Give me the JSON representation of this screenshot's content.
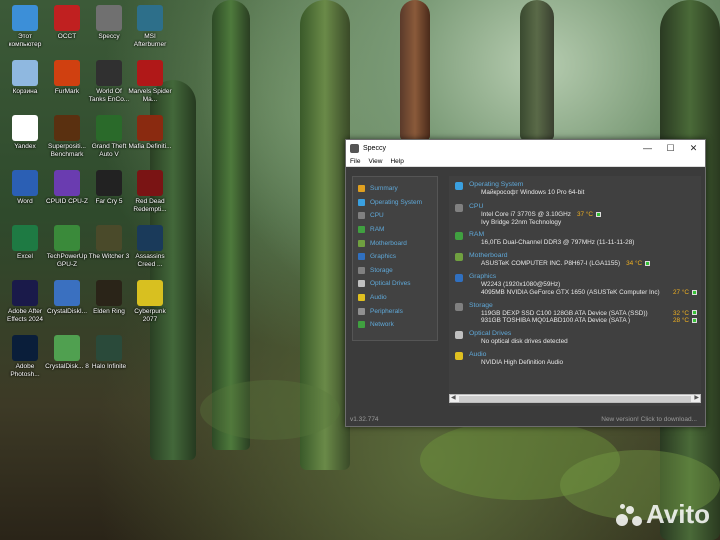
{
  "desktop_icons": [
    {
      "label": "Этот компьютер",
      "icon": "this-pc-icon",
      "color": "#3c8fd8"
    },
    {
      "label": "OCCT",
      "icon": "occt-icon",
      "color": "#c02020"
    },
    {
      "label": "Speccy",
      "icon": "speccy-icon",
      "color": "#707070"
    },
    {
      "label": "MSI Afterburner",
      "icon": "msi-afterburner-icon",
      "color": "#2d6f8a"
    },
    {
      "label": "Корзина",
      "icon": "recycle-bin-icon",
      "color": "#8fb8e0"
    },
    {
      "label": "FurMark",
      "icon": "furmark-icon",
      "color": "#d04010"
    },
    {
      "label": "World Of Tanks EnCo...",
      "icon": "world-of-tanks-icon",
      "color": "#303030"
    },
    {
      "label": "Marvels Spider Ma...",
      "icon": "spider-man-icon",
      "color": "#b01818"
    },
    {
      "label": "Yandex",
      "icon": "yandex-icon",
      "color": "#ffffff"
    },
    {
      "label": "Superpositi... Benchmark",
      "icon": "superposition-icon",
      "color": "#5a3010"
    },
    {
      "label": "Grand Theft Auto V",
      "icon": "gta-v-icon",
      "color": "#2a6a2a"
    },
    {
      "label": "Mafia Definiti...",
      "icon": "mafia-icon",
      "color": "#8a2a10"
    },
    {
      "label": "Word",
      "icon": "word-icon",
      "color": "#2b5fb4"
    },
    {
      "label": "CPUID CPU-Z",
      "icon": "cpu-z-icon",
      "color": "#6a3cb0"
    },
    {
      "label": "Far Cry 5",
      "icon": "far-cry-5-icon",
      "color": "#222222"
    },
    {
      "label": "Red Dead Redempti...",
      "icon": "red-dead-icon",
      "color": "#7a1414"
    },
    {
      "label": "Excel",
      "icon": "excel-icon",
      "color": "#1e7a43"
    },
    {
      "label": "TechPowerUp GPU-Z",
      "icon": "gpu-z-icon",
      "color": "#3a8a3a"
    },
    {
      "label": "The Witcher 3",
      "icon": "witcher-3-icon",
      "color": "#4a4a2a"
    },
    {
      "label": "Assassins Creed ...",
      "icon": "assassins-creed-icon",
      "color": "#1a3a5a"
    },
    {
      "label": "Adobe After Effects 2024",
      "icon": "after-effects-icon",
      "color": "#1a1a4a"
    },
    {
      "label": "CrystalDiskI...",
      "icon": "crystaldiskinfo-icon",
      "color": "#3a70c0"
    },
    {
      "label": "Elden Ring",
      "icon": "elden-ring-icon",
      "color": "#2a2418"
    },
    {
      "label": "Cyberpunk 2077",
      "icon": "cyberpunk-icon",
      "color": "#d8c020"
    },
    {
      "label": "Adobe Photosh...",
      "icon": "photoshop-icon",
      "color": "#0a1e3a"
    },
    {
      "label": "CrystalDisk... 8",
      "icon": "crystaldiskmark-icon",
      "color": "#50a050"
    },
    {
      "label": "Halo Infinite",
      "icon": "halo-icon",
      "color": "#2a4a3a"
    }
  ],
  "window": {
    "title": "Speccy",
    "menu": [
      "File",
      "View",
      "Help"
    ],
    "nav": [
      {
        "label": "Summary",
        "icon": "summary-icon",
        "color": "#e0a020"
      },
      {
        "label": "Operating System",
        "icon": "windows-icon",
        "color": "#3aa0e0"
      },
      {
        "label": "CPU",
        "icon": "cpu-icon",
        "color": "#808080"
      },
      {
        "label": "RAM",
        "icon": "ram-icon",
        "color": "#40a040"
      },
      {
        "label": "Motherboard",
        "icon": "motherboard-icon",
        "color": "#70a040"
      },
      {
        "label": "Graphics",
        "icon": "graphics-icon",
        "color": "#3070c0"
      },
      {
        "label": "Storage",
        "icon": "storage-icon",
        "color": "#808080"
      },
      {
        "label": "Optical Drives",
        "icon": "optical-drive-icon",
        "color": "#c0c0c0"
      },
      {
        "label": "Audio",
        "icon": "audio-icon",
        "color": "#e0c020"
      },
      {
        "label": "Peripherals",
        "icon": "peripherals-icon",
        "color": "#909090"
      },
      {
        "label": "Network",
        "icon": "network-icon",
        "color": "#40a040"
      }
    ],
    "sections": [
      {
        "heading": "Operating System",
        "icon": "windows-icon",
        "color": "#3aa0e0",
        "lines": [
          {
            "text": "Майкрософт Windows 10 Pro 64-bit"
          }
        ]
      },
      {
        "heading": "CPU",
        "icon": "cpu-icon",
        "color": "#808080",
        "lines": [
          {
            "text": "Intel Core i7 3770S @ 3.10GHz",
            "temp": "37 °C"
          },
          {
            "text": "Ivy Bridge 22nm Technology"
          }
        ]
      },
      {
        "heading": "RAM",
        "icon": "ram-icon",
        "color": "#40a040",
        "lines": [
          {
            "text": "16,0ГБ Dual-Channel DDR3 @ 797MHz (11-11-11-28)"
          }
        ]
      },
      {
        "heading": "Motherboard",
        "icon": "motherboard-icon",
        "color": "#70a040",
        "lines": [
          {
            "text": "ASUSTeK COMPUTER INC. P8H67-I (LGA1155)",
            "temp": "34 °C"
          }
        ]
      },
      {
        "heading": "Graphics",
        "icon": "graphics-icon",
        "color": "#3070c0",
        "lines": [
          {
            "text": "W2243 (1920x1080@59Hz)"
          },
          {
            "text": "4095MB NVIDIA GeForce GTX 1650 (ASUSTeK Computer Inc)",
            "temp": "27 °C",
            "temp_right": true
          }
        ]
      },
      {
        "heading": "Storage",
        "icon": "storage-icon",
        "color": "#808080",
        "lines": [
          {
            "text": "119GB DEXP SSD C100 128GB ATA Device (SATA (SSD))",
            "temp": "32 °C",
            "temp_right": true
          },
          {
            "text": "931GB TOSHIBA MQ01ABD100 ATA Device (SATA )",
            "temp": "28 °C",
            "temp_right": true
          }
        ]
      },
      {
        "heading": "Optical Drives",
        "icon": "optical-drive-icon",
        "color": "#c0c0c0",
        "lines": [
          {
            "text": "No optical disk drives detected"
          }
        ]
      },
      {
        "heading": "Audio",
        "icon": "audio-icon",
        "color": "#e0c020",
        "lines": [
          {
            "text": "NVIDIA High Definition Audio"
          }
        ]
      }
    ],
    "version": "v1.32.774",
    "update_notice": "New version! Click to download..."
  },
  "watermark": "Avito"
}
